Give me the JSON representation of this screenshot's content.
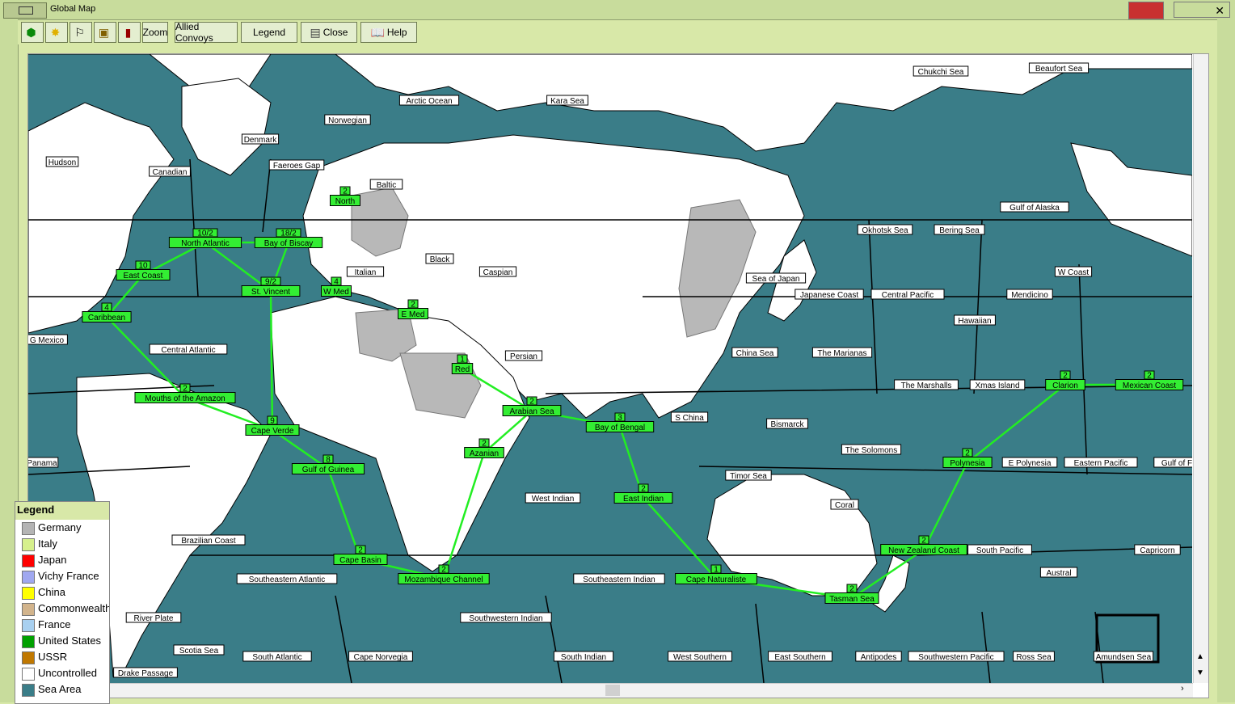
{
  "window": {
    "title": "Global Map"
  },
  "toolbar": {
    "zoom_label": "Zoom",
    "allied_convoys_label": "Allied Convoys",
    "legend_label": "Legend",
    "close_label": "Close",
    "help_label": "Help"
  },
  "colors": {
    "sea": "#3a7d88",
    "route": "#22ee22",
    "label_bg": "#ffffff",
    "convoy_bg": "#33ee33",
    "germany": "#b8b8b8",
    "panel": "#d8e8a8"
  },
  "sea_labels": [
    {
      "text": "Chukchi Sea"
    },
    {
      "text": "Beaufort Sea"
    },
    {
      "text": "Arctic Ocean"
    },
    {
      "text": "Kara Sea"
    },
    {
      "text": "Norwegian"
    },
    {
      "text": "Denmark"
    },
    {
      "text": "Hudson"
    },
    {
      "text": "Canadian"
    },
    {
      "text": "Faeroes Gap"
    },
    {
      "text": "Baltic"
    },
    {
      "text": "Okhotsk Sea"
    },
    {
      "text": "Bering Sea"
    },
    {
      "text": "Gulf of Alaska"
    },
    {
      "text": "W Coast"
    },
    {
      "text": "Black"
    },
    {
      "text": "Italian"
    },
    {
      "text": "Caspian"
    },
    {
      "text": "Sea of Japan"
    },
    {
      "text": "Japanese Coast"
    },
    {
      "text": "Central Pacific"
    },
    {
      "text": "Mendicino"
    },
    {
      "text": "Hawaiian"
    },
    {
      "text": "G Mexico"
    },
    {
      "text": "Central Atlantic"
    },
    {
      "text": "Persian"
    },
    {
      "text": "China Sea"
    },
    {
      "text": "The Marianas"
    },
    {
      "text": "The Marshalls"
    },
    {
      "text": "Xmas Island"
    },
    {
      "text": "S China"
    },
    {
      "text": "Bismarck"
    },
    {
      "text": "The Solomons"
    },
    {
      "text": "Panama"
    },
    {
      "text": "E Polynesia"
    },
    {
      "text": "Eastern Pacific"
    },
    {
      "text": "Gulf of F"
    },
    {
      "text": "Timor Sea"
    },
    {
      "text": "West Indian"
    },
    {
      "text": "Coral"
    },
    {
      "text": "Brazilian Coast"
    },
    {
      "text": "South Pacific"
    },
    {
      "text": "Capricorn"
    },
    {
      "text": "Austral"
    },
    {
      "text": "Southeastern Atlantic"
    },
    {
      "text": "Southeastern Indian"
    },
    {
      "text": "River Plate"
    },
    {
      "text": "Southwestern Indian"
    },
    {
      "text": "Scotia Sea"
    },
    {
      "text": "South Atlantic"
    },
    {
      "text": "Cape Norvegia"
    },
    {
      "text": "South Indian"
    },
    {
      "text": "West Southern"
    },
    {
      "text": "East Southern"
    },
    {
      "text": "Antipodes"
    },
    {
      "text": "Southwestern Pacific"
    },
    {
      "text": "Ross Sea"
    },
    {
      "text": "Amundsen Sea"
    },
    {
      "text": "Drake Passage"
    }
  ],
  "convoy_nodes": [
    {
      "name": "North",
      "count": "2"
    },
    {
      "name": "North Atlantic",
      "count": "10/2"
    },
    {
      "name": "Bay of Biscay",
      "count": "18/2"
    },
    {
      "name": "East Coast",
      "count": "10"
    },
    {
      "name": "St. Vincent",
      "count": "9/2"
    },
    {
      "name": "W Med",
      "count": "4"
    },
    {
      "name": "Caribbean",
      "count": "4"
    },
    {
      "name": "E Med",
      "count": "2"
    },
    {
      "name": "Red",
      "count": "1"
    },
    {
      "name": "Mouths of the Amazon",
      "count": "2"
    },
    {
      "name": "Arabian Sea",
      "count": "2"
    },
    {
      "name": "Bay of Bengal",
      "count": "3"
    },
    {
      "name": "Cape Verde",
      "count": "9"
    },
    {
      "name": "Azanian",
      "count": "2"
    },
    {
      "name": "Gulf of Guinea",
      "count": "8"
    },
    {
      "name": "East Indian",
      "count": "2"
    },
    {
      "name": "Cape Basin",
      "count": "2"
    },
    {
      "name": "Mozambique Channel",
      "count": "2"
    },
    {
      "name": "Cape Naturaliste",
      "count": "1"
    },
    {
      "name": "Tasman Sea",
      "count": "2"
    },
    {
      "name": "New Zealand Coast",
      "count": "2"
    },
    {
      "name": "Polynesia",
      "count": "2"
    },
    {
      "name": "Clarion",
      "count": "2"
    },
    {
      "name": "Mexican Coast",
      "count": "2"
    }
  ],
  "legend": {
    "title": "Legend",
    "items": [
      {
        "label": "Germany",
        "color": "#b4b4b4"
      },
      {
        "label": "Italy",
        "color": "#d6f08c"
      },
      {
        "label": "Japan",
        "color": "#ff0000"
      },
      {
        "label": "Vichy France",
        "color": "#a0a8f0"
      },
      {
        "label": "China",
        "color": "#ffff00"
      },
      {
        "label": "Commonwealth",
        "color": "#d2b48c"
      },
      {
        "label": "France",
        "color": "#a8d0f0"
      },
      {
        "label": "United States",
        "color": "#00a000"
      },
      {
        "label": "USSR",
        "color": "#c07800"
      },
      {
        "label": "Uncontrolled",
        "color": "#ffffff"
      },
      {
        "label": "Sea Area",
        "color": "#3a7d88"
      }
    ]
  }
}
